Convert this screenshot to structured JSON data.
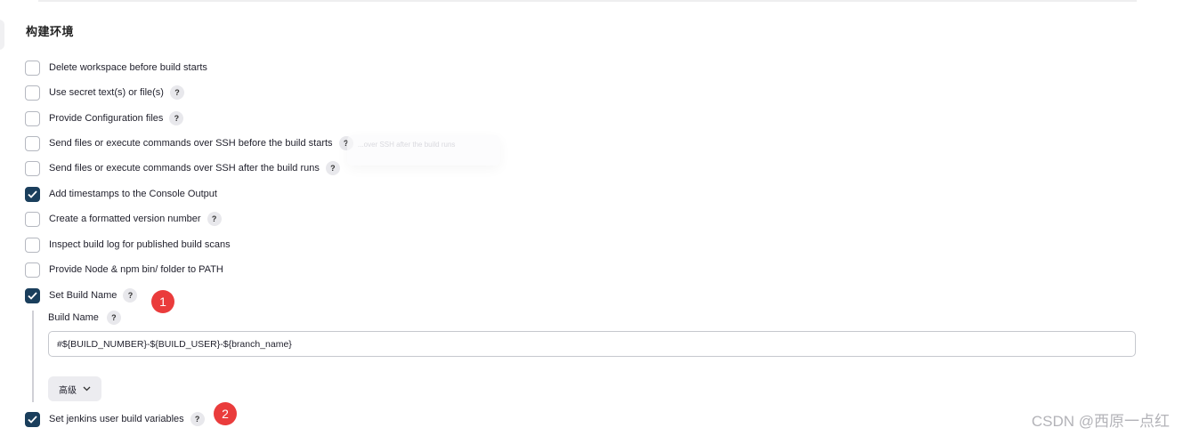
{
  "section": {
    "title": "构建环境"
  },
  "options": [
    {
      "label": "Delete workspace before build starts",
      "checked": false,
      "help": false
    },
    {
      "label": "Use secret text(s) or file(s)",
      "checked": false,
      "help": true
    },
    {
      "label": "Provide Configuration files",
      "checked": false,
      "help": true
    },
    {
      "label": "Send files or execute commands over SSH before the build starts",
      "checked": false,
      "help": true
    },
    {
      "label": "Send files or execute commands over SSH after the build runs",
      "checked": false,
      "help": true
    },
    {
      "label": "Add timestamps to the Console Output",
      "checked": true,
      "help": false
    },
    {
      "label": "Create a formatted version number",
      "checked": false,
      "help": true
    },
    {
      "label": "Inspect build log for published build scans",
      "checked": false,
      "help": false
    },
    {
      "label": "Provide Node & npm bin/ folder to PATH",
      "checked": false,
      "help": false
    },
    {
      "label": "Set Build Name",
      "checked": true,
      "help": true
    },
    {
      "label": "Set jenkins user build variables",
      "checked": true,
      "help": true
    }
  ],
  "help_glyph": "?",
  "tooltip_ghost": "...over SSH after the build runs",
  "build_name": {
    "field_label": "Build Name",
    "value": "#${BUILD_NUMBER}-${BUILD_USER}-${branch_name}",
    "advanced_label": "高级"
  },
  "badges": [
    "1",
    "2"
  ],
  "watermark": "CSDN @西原一点红",
  "colors": {
    "checkbox_checked": "#1a3e5c",
    "badge": "#ea3c3c"
  },
  "icons": {
    "check": "check-icon",
    "help": "help-icon",
    "chevron": "chevron-down-icon"
  }
}
